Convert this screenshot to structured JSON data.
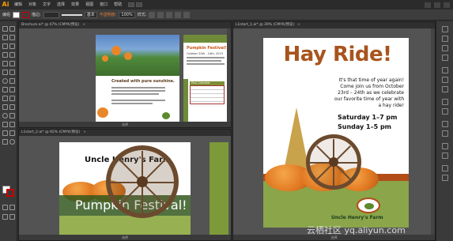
{
  "app": {
    "logo": "Ai",
    "menus": [
      "编辑",
      "对象",
      "文字",
      "选择",
      "效果",
      "视图",
      "窗口",
      "帮助"
    ],
    "colors": {
      "accent": "#ff9a00",
      "workspace": "#323232",
      "panel": "#3d3d3d"
    }
  },
  "control_bar": {
    "selection_label": "编组",
    "stroke_weight_label": "描边:",
    "stroke_style": "基本",
    "opacity_label": "不透明度:",
    "opacity_value": "100%",
    "style_label": "样式:"
  },
  "documents": {
    "brochure": {
      "tab_title": "Brochure.ai* @ 47% (CMYK/预览)",
      "status": "选择",
      "page1_headline": "Created with pure sunshine.",
      "page2_title": "Pumpkin Festival!",
      "page2_subtitle": "October 20th - 24th, 2019",
      "calendar_title": "Pick Calendar"
    },
    "start2": {
      "tab_title": "L1start_2.ai* @ 92% (CMYK/预览)",
      "status": "选择",
      "farm_name": "Uncle Henry's Farm",
      "festival": "Pumpkin Festival!"
    },
    "start": {
      "tab_title": "L1start_1.ai* @ 39% (CMYK/预览)",
      "status": "选择",
      "poster_title": "Hay Ride!",
      "copy_lines": [
        "It's that time of year again!",
        "Come join us from October",
        "23rd – 24th as we celebrate",
        "our favorite time of year with",
        "a hay ride!"
      ],
      "times": [
        "Saturday 1–7 pm",
        "Sunday 1–5 pm"
      ],
      "farm_name": "Uncle Henry's Farm"
    }
  },
  "watermark": "云栖社区 yq.aliyun.com"
}
